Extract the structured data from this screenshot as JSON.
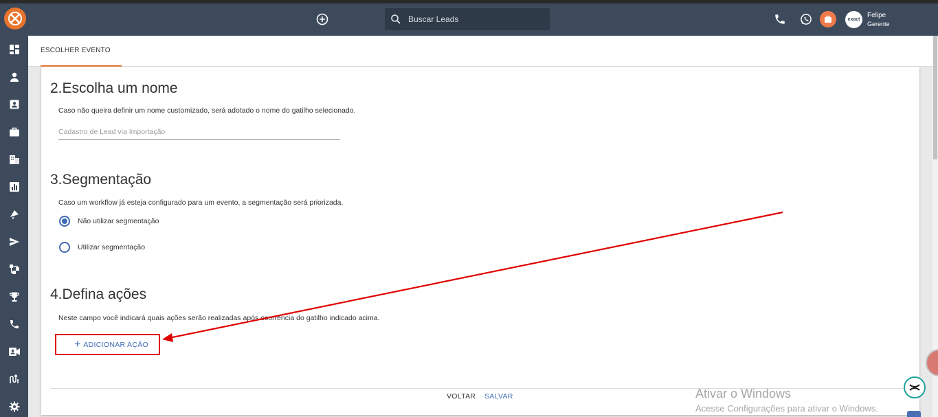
{
  "header": {
    "search_placeholder": "Buscar Leads",
    "user_name": "Felipe",
    "user_role": "Gerente",
    "avatar_text": "exact"
  },
  "sidebar": {
    "items": [
      {
        "icon": "dashboard-icon"
      },
      {
        "icon": "person-icon"
      },
      {
        "icon": "contact-card-icon"
      },
      {
        "icon": "briefcase-icon"
      },
      {
        "icon": "building-icon"
      },
      {
        "icon": "bar-chart-icon"
      },
      {
        "icon": "marketing-icon"
      },
      {
        "icon": "send-icon"
      },
      {
        "icon": "workflow-icon"
      },
      {
        "icon": "trophy-icon"
      },
      {
        "icon": "phone-icon"
      },
      {
        "icon": "video-call-icon"
      },
      {
        "icon": "flow-icon"
      },
      {
        "icon": "gear-icon"
      }
    ]
  },
  "tabs": [
    {
      "label": "ESCOLHER EVENTO"
    }
  ],
  "section_name": {
    "title": "2.Escolha um nome",
    "description": "Caso não queira definir um nome customizado, será adotado o nome do gatilho selecionado.",
    "input_placeholder": "Cadastro de Lead via Importação"
  },
  "section_segment": {
    "title": "3.Segmentação",
    "description": "Caso um workflow já esteja configurado para um evento, a segmentação será priorizada.",
    "options": [
      {
        "label": "Não utilizar segmentação",
        "selected": true
      },
      {
        "label": "Utilizar segmentação",
        "selected": false
      }
    ]
  },
  "section_actions": {
    "title": "4.Defina ações",
    "description": "Neste campo você indicará quais ações serão realizadas após ocorrência do gatilho indicado acima.",
    "add_label": "ADICIONAR AÇÃO"
  },
  "footer": {
    "back_label": "VOLTAR",
    "save_label": "SALVAR"
  },
  "watermark": {
    "title": "Ativar o Windows",
    "subtitle": "Acesse Configurações para ativar o Windows."
  },
  "colors": {
    "header_bg": "#3d4a5c",
    "accent": "#e8752d",
    "primary_blue": "#3f6ab5",
    "annotation_red": "#e00000"
  }
}
